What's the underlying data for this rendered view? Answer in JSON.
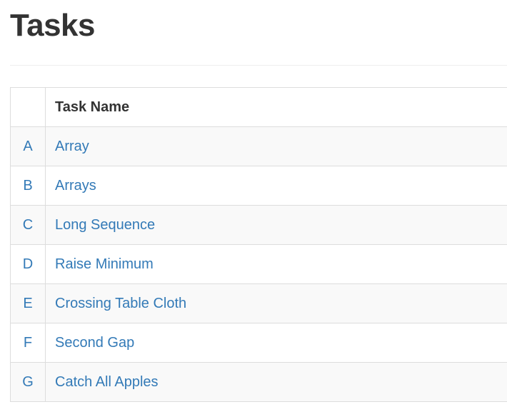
{
  "page": {
    "title": "Tasks"
  },
  "table": {
    "headers": {
      "letter": "",
      "name": "Task Name"
    },
    "rows": [
      {
        "letter": "A",
        "name": "Array"
      },
      {
        "letter": "B",
        "name": "Arrays"
      },
      {
        "letter": "C",
        "name": "Long Sequence"
      },
      {
        "letter": "D",
        "name": "Raise Minimum"
      },
      {
        "letter": "E",
        "name": "Crossing Table Cloth"
      },
      {
        "letter": "F",
        "name": "Second Gap"
      },
      {
        "letter": "G",
        "name": "Catch All Apples"
      }
    ]
  },
  "colors": {
    "text": "#333333",
    "link": "#337ab7",
    "border": "#dddddd",
    "stripe": "#f9f9f9"
  }
}
